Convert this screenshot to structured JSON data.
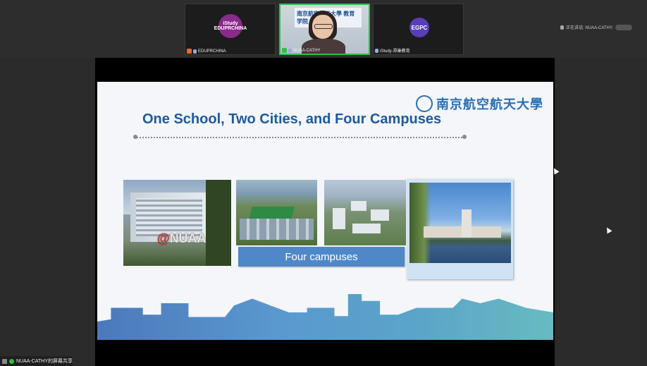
{
  "participants": [
    {
      "name": "EDUPRCHINA",
      "logo_text": "iStudy EDUPRCHINA"
    },
    {
      "name": "NUAA-CATHY",
      "camera_banner": "南京航空航天大學 教育学院",
      "active": true
    },
    {
      "name": "iStudy-郑秦教育",
      "logo_text": "EGPC"
    }
  ],
  "speaking": {
    "label": "正在讲话: NUAA-CATHY;"
  },
  "slide": {
    "title": "One School, Two Cities, and Four Campuses",
    "univ_name": "南京航空航天大學",
    "photo1_sign_red": "@",
    "photo1_sign": "NUAA",
    "caption": "Four campuses"
  },
  "status": {
    "sharing_label": "NUAA-CATHY的屏幕共享"
  }
}
